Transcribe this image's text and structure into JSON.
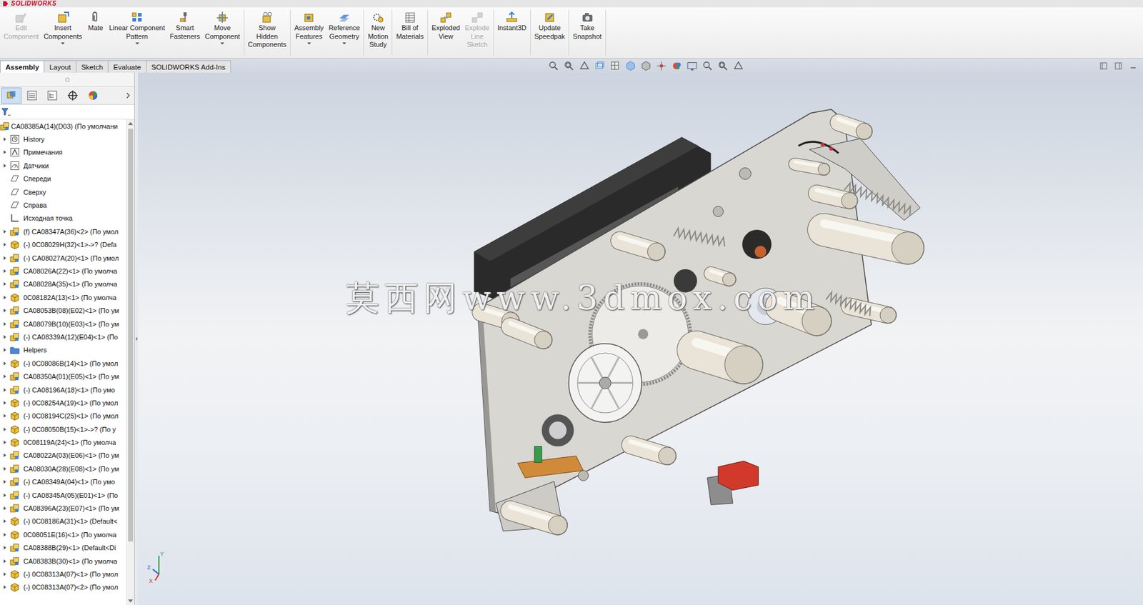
{
  "app": {
    "logo": "SOLIDWORKS"
  },
  "command_groups": [
    [
      {
        "lines": [
          "Edit",
          "Component"
        ],
        "disabled": true,
        "dropdown": false
      },
      {
        "lines": [
          "Insert",
          "Components"
        ],
        "disabled": false,
        "dropdown": true
      },
      {
        "lines": [
          "Mate"
        ],
        "disabled": false,
        "dropdown": false
      },
      {
        "lines": [
          "Linear Component",
          "Pattern"
        ],
        "disabled": false,
        "dropdown": true
      },
      {
        "lines": [
          "Smart",
          "Fasteners"
        ],
        "disabled": false,
        "dropdown": false
      },
      {
        "lines": [
          "Move",
          "Component"
        ],
        "disabled": false,
        "dropdown": true
      }
    ],
    [
      {
        "lines": [
          "Show",
          "Hidden",
          "Components"
        ],
        "disabled": false,
        "dropdown": false
      }
    ],
    [
      {
        "lines": [
          "Assembly",
          "Features"
        ],
        "disabled": false,
        "dropdown": true
      },
      {
        "lines": [
          "Reference",
          "Geometry"
        ],
        "disabled": false,
        "dropdown": true
      }
    ],
    [
      {
        "lines": [
          "New",
          "Motion",
          "Study"
        ],
        "disabled": false,
        "dropdown": false
      }
    ],
    [
      {
        "lines": [
          "Bill of",
          "Materials"
        ],
        "disabled": false,
        "dropdown": false
      }
    ],
    [
      {
        "lines": [
          "Exploded",
          "View"
        ],
        "disabled": false,
        "dropdown": false
      },
      {
        "lines": [
          "Explode",
          "Line",
          "Sketch"
        ],
        "disabled": true,
        "dropdown": false
      }
    ],
    [
      {
        "lines": [
          "Instant3D"
        ],
        "disabled": false,
        "dropdown": false
      }
    ],
    [
      {
        "lines": [
          "Update",
          "Speedpak"
        ],
        "disabled": false,
        "dropdown": false
      }
    ],
    [
      {
        "lines": [
          "Take",
          "Snapshot"
        ],
        "disabled": false,
        "dropdown": false
      }
    ]
  ],
  "tabs": [
    {
      "label": "Assembly",
      "selected": true
    },
    {
      "label": "Layout",
      "selected": false
    },
    {
      "label": "Sketch",
      "selected": false
    },
    {
      "label": "Evaluate",
      "selected": false
    },
    {
      "label": "SOLIDWORKS Add-Ins",
      "selected": false
    }
  ],
  "panel_tabs": [
    {
      "selected": true
    },
    {
      "selected": false
    },
    {
      "selected": false
    },
    {
      "selected": false
    },
    {
      "selected": false
    }
  ],
  "tree": {
    "root": {
      "label": "CA08385A(14)(D03) (По умолчани",
      "kind": "assembly",
      "expanded": true
    },
    "items": [
      {
        "label": "History",
        "kind": "history",
        "expandable": true
      },
      {
        "label": "Примечания",
        "kind": "annotations",
        "expandable": true
      },
      {
        "label": "Датчики",
        "kind": "sensors",
        "expandable": true
      },
      {
        "label": "Спереди",
        "kind": "plane",
        "expandable": false
      },
      {
        "label": "Сверху",
        "kind": "plane",
        "expandable": false
      },
      {
        "label": "Справа",
        "kind": "plane",
        "expandable": false
      },
      {
        "label": "Исходная точка",
        "kind": "origin",
        "expandable": false
      },
      {
        "label": "(f) CA08347A(36)<2> (По умол",
        "kind": "subassembly",
        "expandable": true
      },
      {
        "label": "(-) 0C08029H(32)<1>->? (Defa",
        "kind": "part",
        "expandable": true
      },
      {
        "label": "(-) CA08027A(20)<1> (По умол",
        "kind": "subassembly",
        "expandable": true
      },
      {
        "label": "CA08026A(22)<1> (По умолча",
        "kind": "subassembly",
        "expandable": true
      },
      {
        "label": "CA08028A(35)<1> (По умолча",
        "kind": "subassembly",
        "expandable": true
      },
      {
        "label": "0C08182A(13)<1> (По умолча",
        "kind": "part",
        "expandable": true
      },
      {
        "label": "CA08053B(08)(E02)<1> (По ум",
        "kind": "subassembly",
        "expandable": true
      },
      {
        "label": "CA08079B(10)(E03)<1> (По ум",
        "kind": "subassembly",
        "expandable": true
      },
      {
        "label": "(-) CA08339A(12)(E04)<1> (По",
        "kind": "subassembly",
        "expandable": true
      },
      {
        "label": "Helpers",
        "kind": "folder",
        "expandable": true
      },
      {
        "label": "(-) 0C08086B(14)<1> (По умол",
        "kind": "part",
        "expandable": true
      },
      {
        "label": "CA08350A(01)(E05)<1> (По ум",
        "kind": "subassembly",
        "expandable": true
      },
      {
        "label": "(-) CA08196A(18)<1> (По умо",
        "kind": "subassembly",
        "expandable": true
      },
      {
        "label": "(-) 0C08254A(19)<1> (По умол",
        "kind": "part",
        "expandable": true
      },
      {
        "label": "(-) 0C08194C(25)<1> (По умол",
        "kind": "part",
        "expandable": true
      },
      {
        "label": "(-) 0C08050B(15)<1>->? (По у",
        "kind": "part",
        "expandable": true
      },
      {
        "label": "0C08119A(24)<1> (По умолча",
        "kind": "part",
        "expandable": true
      },
      {
        "label": "CA08022A(03)(E06)<1> (По ум",
        "kind": "subassembly",
        "expandable": true
      },
      {
        "label": "CA08030A(28)(E08)<1> (По ум",
        "kind": "subassembly",
        "expandable": true
      },
      {
        "label": "(-) CA08349A(04)<1> (По умо",
        "kind": "subassembly",
        "expandable": true
      },
      {
        "label": "(-) CA08345A(05)(E01)<1> (По",
        "kind": "subassembly",
        "expandable": true
      },
      {
        "label": "CA08396A(23)(E07)<1> (По ум",
        "kind": "subassembly",
        "expandable": true
      },
      {
        "label": "(-) 0C08186A(31)<1> (Default<",
        "kind": "part",
        "expandable": true
      },
      {
        "label": "0C08051E(16)<1> (По умолча",
        "kind": "part",
        "expandable": true
      },
      {
        "label": "CA08388B(29)<1> (Default<Di",
        "kind": "subassembly",
        "expandable": true
      },
      {
        "label": "CA08383B(30)<1> (По умолча",
        "kind": "subassembly",
        "expandable": true
      },
      {
        "label": "(-) 0C08313A(07)<1> (По умол",
        "kind": "part",
        "expandable": true
      },
      {
        "label": "(-) 0C08313A(07)<2> (По умол",
        "kind": "part",
        "expandable": true
      }
    ]
  },
  "viewport": {
    "watermark": "莫西网www.3dmox.com",
    "triad": {
      "x": "X",
      "y": "Y",
      "z": "Z"
    }
  }
}
